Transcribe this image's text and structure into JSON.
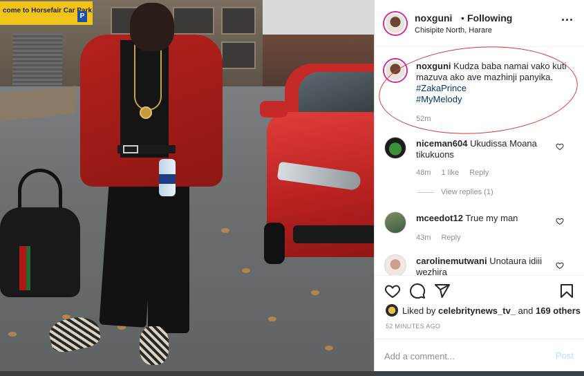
{
  "photo": {
    "sign_text": "come to Horsefair Car Park",
    "sign_badge": "P"
  },
  "post": {
    "username": "noxguni",
    "separator": "•",
    "follow_status": "Following",
    "location": "Chisipite North, Harare",
    "more_icon": "ellipsis-icon"
  },
  "caption": {
    "username": "noxguni",
    "text": "Kudza baba namai vako kuti mazuva ako ave mazhinji panyika.",
    "hashtags": [
      "#ZakaPrince",
      "#MyMelody"
    ],
    "age": "52m"
  },
  "comments": [
    {
      "username": "niceman604",
      "text": "Ukudissa Moana tikukuons",
      "age": "48m",
      "likes": "1 like",
      "reply": "Reply"
    },
    {
      "username": "mceedot12",
      "text": "True my man",
      "age": "43m",
      "reply": "Reply"
    },
    {
      "username": "carolinemutwani",
      "text": "Unotaura idiii wezhira"
    }
  ],
  "view_replies": "View replies (1)",
  "actions": [
    "heart-icon",
    "comment-icon",
    "share-icon",
    "bookmark-icon"
  ],
  "likes": {
    "prefix": "Liked by ",
    "user": "celebritynews_tv_",
    "middle": " and ",
    "others": "169 others"
  },
  "timestamp": "52 MINUTES AGO",
  "comment_box": {
    "placeholder": "Add a comment...",
    "post_label": "Post"
  },
  "colors": {
    "link": "#00376b",
    "muted": "#8e8e8e",
    "post_disabled": "#b2dffc",
    "annotation_red": "#d43a3a"
  }
}
